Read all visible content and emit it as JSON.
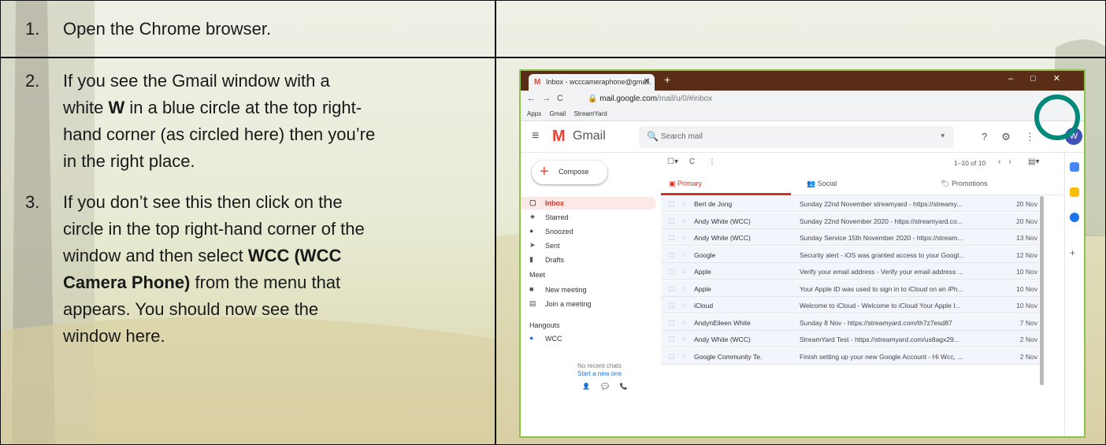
{
  "steps": [
    {
      "num": "1.",
      "lines": [
        "Open the Chrome browser."
      ]
    },
    {
      "num": "2.",
      "lines": [
        "If you see the Gmail window with a",
        "hand corner (as circled here) then you’re",
        "in the right place."
      ],
      "line2_pre": "white ",
      "line2_bold": "W",
      "line2_post": " in a blue circle at the top right-"
    },
    {
      "num": "3.",
      "lines": [
        "If you don’t see this then click on the",
        "circle in the top right-hand corner of the",
        "window and then select ",
        "appears.  You should now see the",
        "window here."
      ],
      "bold1": "WCC (WCC",
      "bold2": "Camera Phone)",
      "after_bold": " from the menu that"
    }
  ],
  "browser": {
    "tab_title": "Inbox - wcccameraphone@gmail.",
    "url_host": "mail.google.com",
    "url_path": "/mail/u/0/#inbox",
    "bookmarks": [
      "Apps",
      "Gmail",
      "StreamYard"
    ]
  },
  "gmail": {
    "title": "Gmail",
    "search_placeholder": "Search mail",
    "avatar_letter": "W",
    "compose": "Compose",
    "pager": "1–10 of 10",
    "tabs": [
      "Primary",
      "Social",
      "Promotions"
    ],
    "nav": [
      {
        "label": "Inbox",
        "icon": "▢"
      },
      {
        "label": "Starred",
        "icon": "★"
      },
      {
        "label": "Snoozed",
        "icon": "●"
      },
      {
        "label": "Sent",
        "icon": "➤"
      },
      {
        "label": "Drafts",
        "icon": "▮"
      }
    ],
    "meet_heading": "Meet",
    "meet_items": [
      {
        "label": "New meeting",
        "icon": "■"
      },
      {
        "label": "Join a meeting",
        "icon": "▤"
      }
    ],
    "hangouts_heading": "Hangouts",
    "hangouts_user": "WCC",
    "no_chats": "No recent chats",
    "start_new": "Start a new one",
    "emails": [
      {
        "sender": "Bert de Jong",
        "subject": "Sunday 22nd November streamyard - https://streamy...",
        "date": "20 Nov"
      },
      {
        "sender": "Andy White (WCC)",
        "subject": "Sunday 22nd November 2020 - https://streamyard.co...",
        "date": "20 Nov"
      },
      {
        "sender": "Andy White (WCC)",
        "subject": "Sunday Service 15th November 2020 - https://stream...",
        "date": "13 Nov"
      },
      {
        "sender": "Google",
        "subject": "Security alert - iOS was granted access to your Googl...",
        "date": "12 Nov"
      },
      {
        "sender": "Apple",
        "subject": "Verify your email address - Verify your email address ...",
        "date": "10 Nov"
      },
      {
        "sender": "Apple",
        "subject": "Your Apple ID was used to sign in to iCloud on an iPh...",
        "date": "10 Nov"
      },
      {
        "sender": "iCloud",
        "subject": "Welcome to iCloud - Welcome to iCloud Your Apple I...",
        "date": "10 Nov"
      },
      {
        "sender": "AndynEileen White",
        "subject": "Sunday 8 Nov - https://streamyard.com/th7z7esd87",
        "date": "7 Nov"
      },
      {
        "sender": "Andy White (WCC)",
        "subject": "StreamYard Test - https://streamyard.com/us8agx29...",
        "date": "2 Nov"
      },
      {
        "sender": "Google Community Te.",
        "subject": "Finish setting up your new Google Account - Hi Wcc, ...",
        "date": "2 Nov"
      }
    ]
  },
  "colors": {
    "circle": "#00897b",
    "shot_border": "#8bc34a",
    "chrome_frame": "#5a2d17"
  }
}
